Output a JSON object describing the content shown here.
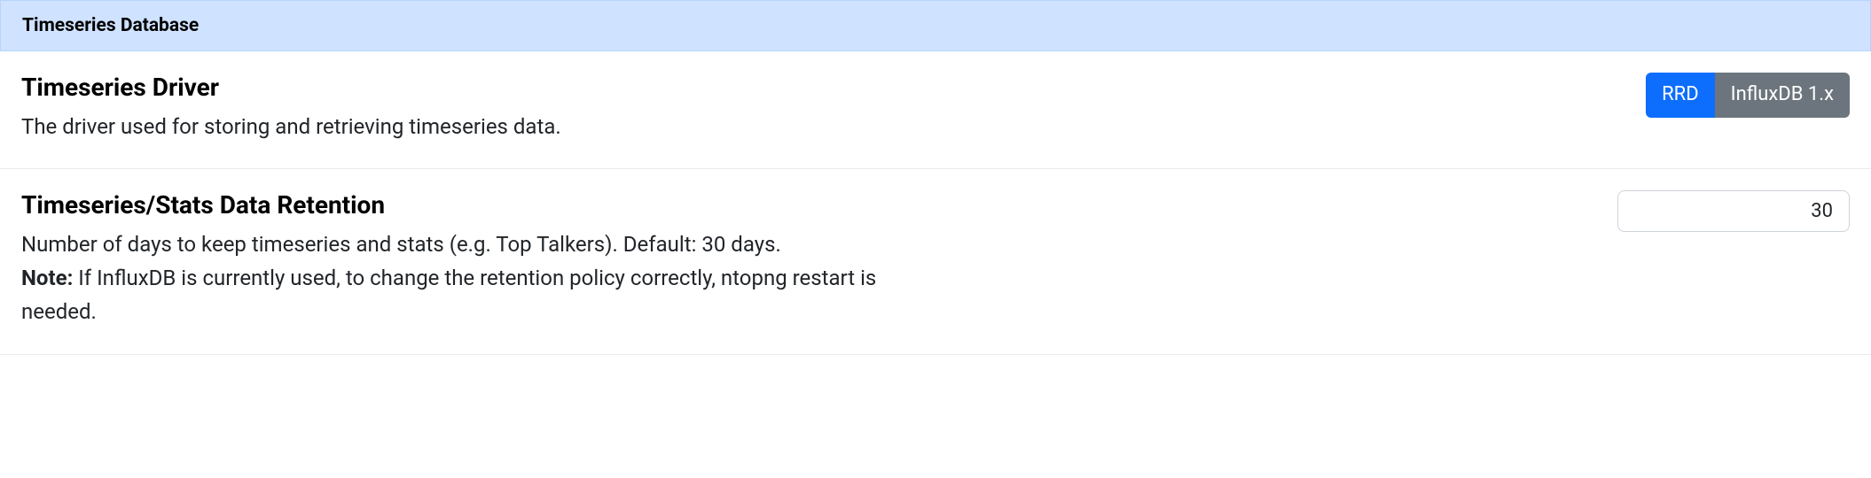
{
  "section": {
    "header": "Timeseries Database",
    "settings": [
      {
        "title": "Timeseries Driver",
        "description": "The driver used for storing and retrieving timeseries data.",
        "options": {
          "rrd": "RRD",
          "influxdb": "InfluxDB 1.x"
        },
        "selected": "rrd"
      },
      {
        "title": "Timeseries/Stats Data Retention",
        "description_line1": "Number of days to keep timeseries and stats (e.g. Top Talkers). Default: 30 days.",
        "note_label": "Note:",
        "note_text": " If InfluxDB is currently used, to change the retention policy correctly, ntopng restart is needed.",
        "value": "30"
      }
    ]
  }
}
